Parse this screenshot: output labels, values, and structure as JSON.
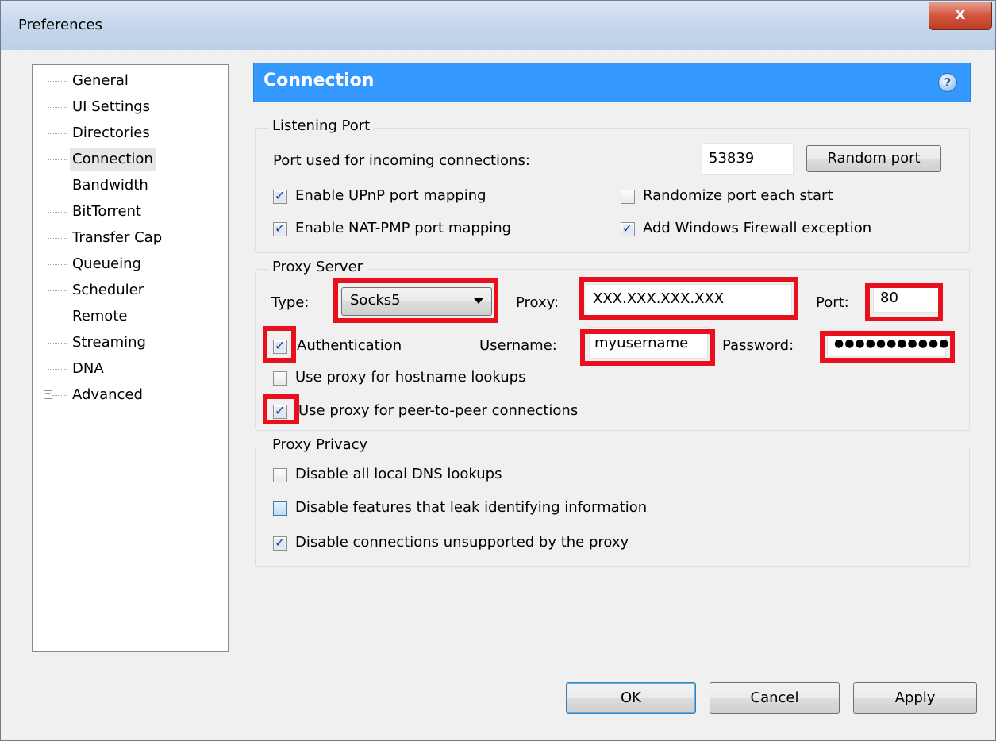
{
  "window": {
    "title": "Preferences",
    "close_label": "x"
  },
  "sidebar": {
    "items": [
      {
        "label": "General"
      },
      {
        "label": "UI Settings"
      },
      {
        "label": "Directories"
      },
      {
        "label": "Connection",
        "selected": true
      },
      {
        "label": "Bandwidth"
      },
      {
        "label": "BitTorrent"
      },
      {
        "label": "Transfer Cap"
      },
      {
        "label": "Queueing"
      },
      {
        "label": "Scheduler"
      },
      {
        "label": "Remote"
      },
      {
        "label": "Streaming"
      },
      {
        "label": "DNA"
      },
      {
        "label": "Advanced",
        "expandable": true
      }
    ]
  },
  "header": {
    "title": "Connection",
    "help": "?"
  },
  "listening_port": {
    "title": "Listening Port",
    "port_label": "Port used for incoming connections:",
    "port_value": "53839",
    "random_button": "Random port",
    "upnp": {
      "label": "Enable UPnP port mapping",
      "checked": true
    },
    "natpmp": {
      "label": "Enable NAT-PMP port mapping",
      "checked": true
    },
    "randomize": {
      "label": "Randomize port each start",
      "checked": false
    },
    "firewall": {
      "label": "Add Windows Firewall exception",
      "checked": true
    }
  },
  "proxy_server": {
    "title": "Proxy Server",
    "type_label": "Type:",
    "type_value": "Socks5",
    "proxy_label": "Proxy:",
    "proxy_value": "XXX.XXX.XXX.XXX",
    "port_label": "Port:",
    "port_value": "80",
    "auth": {
      "label": "Authentication",
      "checked": true
    },
    "username_label": "Username:",
    "username_value": "myusername",
    "password_label": "Password:",
    "password_value": "●●●●●●●●●●●",
    "hostname": {
      "label": "Use proxy for hostname lookups",
      "checked": false
    },
    "p2p": {
      "label": "Use proxy for peer-to-peer connections",
      "checked": true
    }
  },
  "proxy_privacy": {
    "title": "Proxy Privacy",
    "dns": {
      "label": "Disable all local DNS lookups",
      "checked": false
    },
    "leak": {
      "label": "Disable features that leak identifying information",
      "checked": false
    },
    "unsupported": {
      "label": "Disable connections unsupported by the proxy",
      "checked": true
    }
  },
  "footer": {
    "ok": "OK",
    "cancel": "Cancel",
    "apply": "Apply"
  },
  "colors": {
    "header_bg": "#3399ff",
    "highlight": "#e8101d"
  }
}
